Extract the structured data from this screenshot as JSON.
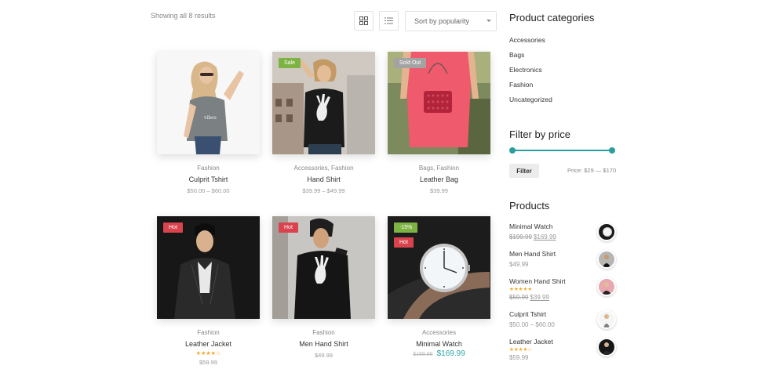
{
  "shop": {
    "result_count": "Showing all 8 results",
    "sort_selected": "Sort by popularity"
  },
  "products": [
    {
      "category": "Fashion",
      "name": "Culprit Tshirt",
      "price": "$50.00 – $60.00",
      "badge": ""
    },
    {
      "category": "Accessories, Fashion",
      "name": "Hand Shirt",
      "price": "$39.99 – $49.99",
      "badge": "Sale"
    },
    {
      "category": "Bags, Fashion",
      "name": "Leather Bag",
      "price": "$39.99",
      "badge": "Sold Out"
    },
    {
      "category": "Fashion",
      "name": "Leather Jacket",
      "price": "$59.99",
      "badge": "Hot",
      "rating": 3.5
    },
    {
      "category": "Fashion",
      "name": "Men Hand Shirt",
      "price": "$49.99",
      "badge": "Hot"
    },
    {
      "category": "Accessories",
      "name": "Minimal Watch",
      "old_price": "$199.99",
      "new_price": "$169.99",
      "badge": "Hot",
      "badge2": "-15%"
    }
  ],
  "sidebar": {
    "categories_title": "Product categories",
    "categories": [
      "Accessories",
      "Bags",
      "Electronics",
      "Fashion",
      "Uncategorized"
    ],
    "price_title": "Filter by price",
    "filter_label": "Filter",
    "price_range": "Price: $29 — $170",
    "products_title": "Products",
    "products": [
      {
        "name": "Minimal Watch",
        "old": "$199.99",
        "new": "$169.99"
      },
      {
        "name": "Men Hand Shirt",
        "price": "$49.99"
      },
      {
        "name": "Women Hand Shirt",
        "old": "$59.99",
        "new": "$39.99",
        "rating": 5
      },
      {
        "name": "Culprit Tshirt",
        "price": "$50.00 – $60.00"
      },
      {
        "name": "Leather Jacket",
        "price": "$59.99",
        "rating": 3.5
      }
    ]
  },
  "colors": {
    "accent": "#2a9d9d",
    "sale": "#7cb342",
    "hot": "#d9434e",
    "soldout": "#a3a3a3",
    "star": "#f5a623"
  }
}
